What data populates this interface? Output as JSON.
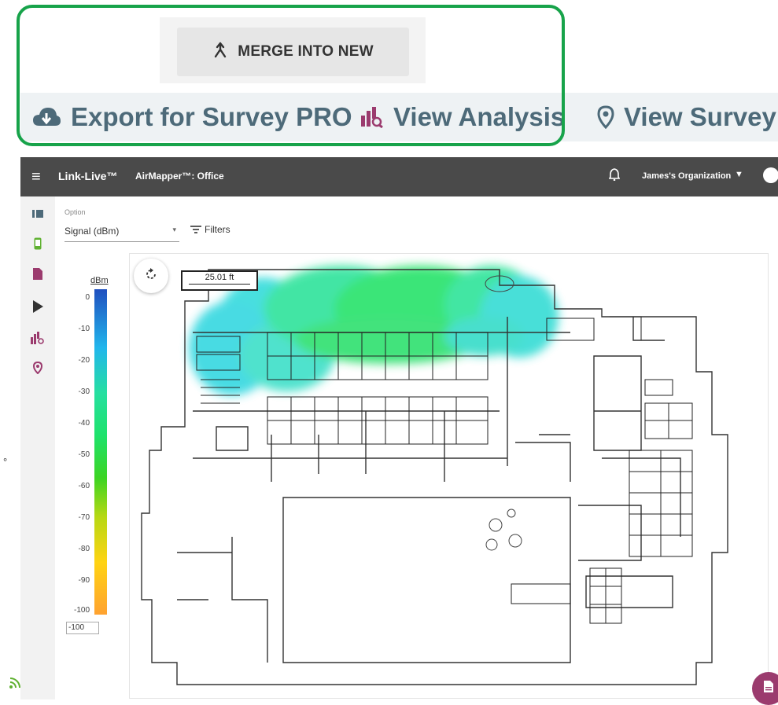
{
  "toolbar": {
    "merge_label": "MERGE INTO NEW"
  },
  "actions": {
    "export_label": "Export for Survey PRO",
    "analysis_label": "View Analysis",
    "survey_label": "View Survey"
  },
  "appbar": {
    "brand": "Link-Live™",
    "page_title": "AirMapper™: Office",
    "org": "James's Organization"
  },
  "panel": {
    "option_label": "Option",
    "option_value": "Signal (dBm)",
    "filters_label": "Filters"
  },
  "legend": {
    "unit": "dBm",
    "ticks": [
      "0",
      "-10",
      "-20",
      "-30",
      "-40",
      "-50",
      "-60",
      "-70",
      "-80",
      "-90",
      "-100"
    ],
    "min_value": "-100"
  },
  "map": {
    "scale_label": "25.01 ft"
  },
  "colors": {
    "highlight": "#17a34a",
    "action_text": "#4d6a79",
    "nav_analysis": "#9b3b6e",
    "nav_device": "#5fb130",
    "fab": "#9b3b6e"
  }
}
